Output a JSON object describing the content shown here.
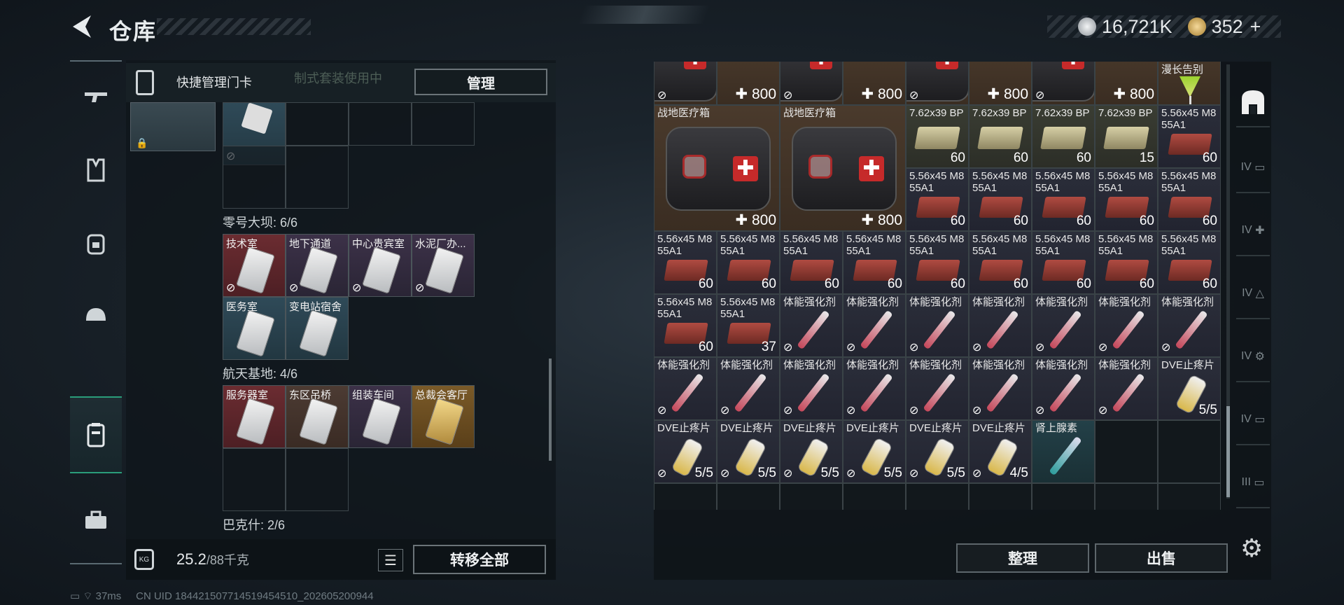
{
  "header": {
    "title": "仓库",
    "currency_silver": "16,721K",
    "currency_gold": "352",
    "plus": "+"
  },
  "rail_icons": [
    "rifle-icon",
    "vest-icon",
    "backpack-icon",
    "helmet-icon",
    "keycard-case-icon",
    "toolbox-icon"
  ],
  "left": {
    "quick_label": "快捷管理门卡",
    "faint_text": "制式套装使用中",
    "manage_label": "管理",
    "sections": [
      {
        "label": "零号大坝: 6/6",
        "cards": [
          {
            "name": "技术室",
            "color": "red"
          },
          {
            "name": "地下通道",
            "color": "purple"
          },
          {
            "name": "中心贵宾室",
            "color": "purple"
          },
          {
            "name": "水泥厂办...",
            "color": "purple"
          },
          {
            "name": "医务室",
            "color": "blue"
          },
          {
            "name": "变电站宿舍",
            "color": "blue"
          }
        ]
      },
      {
        "label": "航天基地: 4/6",
        "cards": [
          {
            "name": "服务器室",
            "color": "red"
          },
          {
            "name": "东区吊桥",
            "color": "brown"
          },
          {
            "name": "组装车间",
            "color": "purple"
          },
          {
            "name": "总裁会客厅",
            "color": "gold"
          }
        ]
      },
      {
        "label": "巴克什: 2/6",
        "cards": []
      }
    ],
    "weight_current": "25.2",
    "weight_total": "/88千克",
    "transfer_label": "转移全部"
  },
  "status": {
    "ping": "37ms",
    "uid": "CN UID 184421507714519454510_202605200944"
  },
  "right": {
    "top_row_count": "✚ 800",
    "cocktail_name": "漫长告别",
    "medkit_name": "战地医疗箱",
    "medkit_count": "✚ 800",
    "ammo_bp_name": "7.62x39 BP",
    "ammo_556_name": "5.56x45 M855A1",
    "stim_name": "体能强化剂",
    "dve_name": "DVE止疼片",
    "adrenaline_name": "肾上腺素",
    "bp_counts": [
      "60",
      "60",
      "60",
      "15"
    ],
    "sort_label": "整理",
    "sell_label": "出售"
  },
  "rrail_labels": [
    "IV",
    "IV",
    "IV",
    "IV",
    "IV",
    "III"
  ]
}
